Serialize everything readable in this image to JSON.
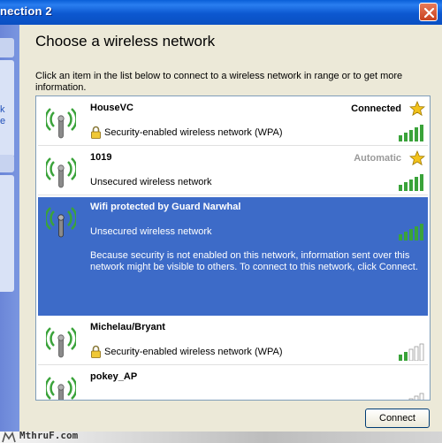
{
  "window": {
    "title": "nection 2",
    "close_icon": "close-x-icon"
  },
  "left_pane": {
    "link_fragment": "k\ne"
  },
  "dialog": {
    "heading": "Choose a wireless network",
    "instructions": "Click an item in the list below to connect to a wireless network in range or to get more information."
  },
  "networks": [
    {
      "name": "HouseVC",
      "status": "Connected",
      "security": "Security-enabled wireless network (WPA)",
      "secured": true,
      "preferred": true,
      "signal_bars": 5
    },
    {
      "name": "1019",
      "status": "Automatic",
      "security": "Unsecured wireless network",
      "secured": false,
      "preferred": true,
      "signal_bars": 5
    },
    {
      "name": "Wifi protected by Guard Narwhal",
      "status": "",
      "security": "Unsecured wireless network",
      "secured": false,
      "preferred": false,
      "signal_bars": 5,
      "description": "Because security is not enabled on this network, information sent over this network might be visible to others. To connect to this network, click Connect."
    },
    {
      "name": "Michelau/Bryant",
      "status": "",
      "security": "Security-enabled wireless network (WPA)",
      "secured": true,
      "preferred": false,
      "signal_bars": 2
    },
    {
      "name": "pokey_AP",
      "status": "",
      "security": "",
      "secured": false,
      "preferred": false,
      "signal_bars": 1
    }
  ],
  "buttons": {
    "connect": "Connect"
  },
  "watermark": {
    "text": "MthruF.com"
  },
  "colors": {
    "titlebar": "#0a5fd8",
    "selected_row": "#3d6bc8",
    "signal_green": "#3aa33a",
    "star_gold": "#f2c21b"
  }
}
